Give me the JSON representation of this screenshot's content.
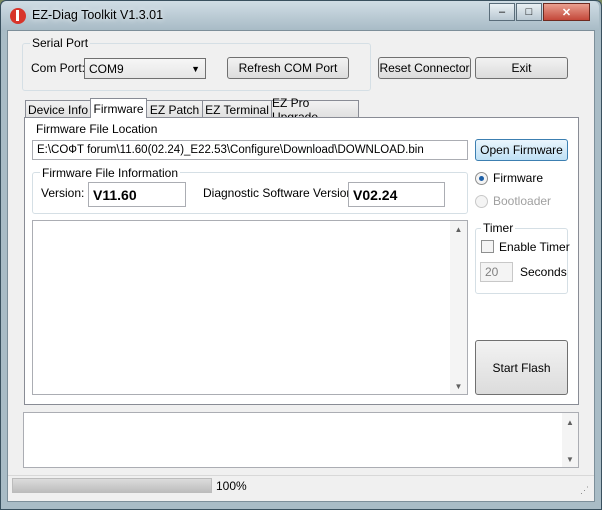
{
  "window": {
    "title": "EZ-Diag Toolkit V1.3.01",
    "minimize_glyph": "–",
    "maximize_glyph": "□",
    "close_glyph": "✕"
  },
  "serial_port": {
    "group_label": "Serial Port",
    "com_port_label": "Com Port:",
    "com_port_value": "COM9",
    "refresh_button": "Refresh COM Port"
  },
  "toolbar": {
    "reset_connector": "Reset Connector",
    "exit": "Exit"
  },
  "tabs": [
    {
      "label": "Device Info"
    },
    {
      "label": "Firmware"
    },
    {
      "label": "EZ Patch"
    },
    {
      "label": "EZ Terminal"
    },
    {
      "label": "EZ Pro Upgrade"
    }
  ],
  "firmware": {
    "file_location_label": "Firmware File Location",
    "file_path": "E:\\COФT forum\\11.60(02.24)_E22.53\\Configure\\Download\\DOWNLOAD.bin",
    "open_button": "Open Firmware",
    "info_group_label": "Firmware File Information",
    "version_label": "Version:",
    "version_value": "V11.60",
    "diag_label": "Diagnostic Software Version:",
    "diag_value": "V02.24",
    "radio_firmware": "Firmware",
    "radio_bootloader": "Bootloader",
    "timer_group_label": "Timer",
    "enable_timer_label": "Enable Timer",
    "timer_value": "20",
    "seconds_label": "Seconds",
    "start_flash": "Start Flash"
  },
  "status": {
    "progress_text": "100%",
    "progress_fraction": 1.0
  },
  "colors": {
    "title_bar": "#a7bac5",
    "close_button": "#c4483a",
    "progress_fill": "#c8c8c8",
    "focus_border": "#3c7fb1"
  }
}
